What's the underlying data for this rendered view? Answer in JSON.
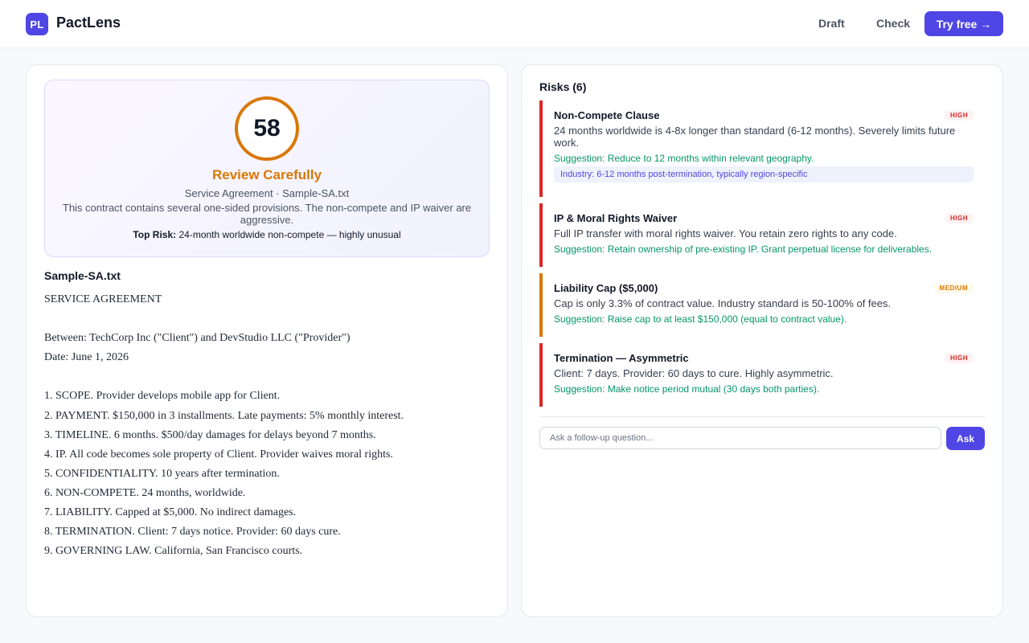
{
  "header": {
    "logo_text": "PL",
    "brand": "PactLens",
    "nav": [
      "Draft",
      "Check"
    ],
    "cta_label": "Try free",
    "cta_arrow": "→"
  },
  "score": {
    "value": "58",
    "verdict": "Review Carefully",
    "meta": "Service Agreement · Sample-SA.txt",
    "description": "This contract contains several one-sided provisions. The non-compete and IP waiver are aggressive.",
    "top_risk_label": "Top Risk:",
    "top_risk_text": " 24-month worldwide non-compete — highly unusual",
    "ring_color": "#d97706"
  },
  "document": {
    "filename": "Sample-SA.txt",
    "lines": [
      "SERVICE AGREEMENT",
      "",
      "Between: TechCorp Inc (\"Client\") and DevStudio LLC (\"Provider\")",
      "Date: June 1, 2026",
      "",
      "1. SCOPE. Provider develops mobile app for Client.",
      "2. PAYMENT. $150,000 in 3 installments. Late payments: 5% monthly interest.",
      "3. TIMELINE. 6 months. $500/day damages for delays beyond 7 months.",
      "4. IP. All code becomes sole property of Client. Provider waives moral rights.",
      "5. CONFIDENTIALITY. 10 years after termination.",
      "6. NON-COMPETE. 24 months, worldwide.",
      "7. LIABILITY. Capped at $5,000. No indirect damages.",
      "8. TERMINATION. Client: 7 days notice. Provider: 60 days cure.",
      "9. GOVERNING LAW. California, San Francisco courts."
    ]
  },
  "risks": {
    "title": "Risks (6)",
    "items": [
      {
        "name": "Non-Compete Clause",
        "severity": "HIGH",
        "description": "24 months worldwide is 4-8x longer than standard (6-12 months). Severely limits future work.",
        "suggestion": "Suggestion: Reduce to 12 months within relevant geography.",
        "industry": "Industry: 6-12 months post-termination, typically region-specific"
      },
      {
        "name": "IP & Moral Rights Waiver",
        "severity": "HIGH",
        "description": "Full IP transfer with moral rights waiver. You retain zero rights to any code.",
        "suggestion": "Suggestion: Retain ownership of pre-existing IP. Grant perpetual license for deliverables."
      },
      {
        "name": "Liability Cap ($5,000)",
        "severity": "MEDIUM",
        "description": "Cap is only 3.3% of contract value. Industry standard is 50-100% of fees.",
        "suggestion": "Suggestion: Raise cap to at least $150,000 (equal to contract value)."
      },
      {
        "name": "Termination — Asymmetric",
        "severity": "HIGH",
        "description": "Client: 7 days. Provider: 60 days to cure. Highly asymmetric.",
        "suggestion": "Suggestion: Make notice period mutual (30 days both parties)."
      }
    ]
  },
  "ask": {
    "placeholder": "Ask a follow-up question...",
    "button": "Ask"
  },
  "colors": {
    "accent": "#4f46e5",
    "high": "#dc2626",
    "medium": "#d97706",
    "suggestion": "#059669"
  }
}
